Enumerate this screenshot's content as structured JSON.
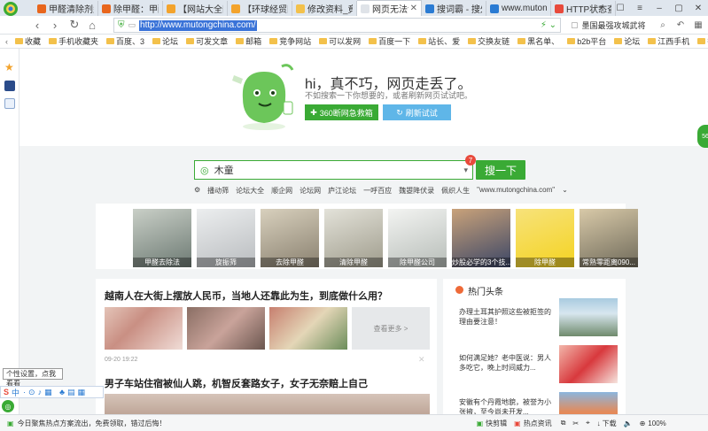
{
  "tabs": [
    {
      "label": "甲醛清除剂型",
      "color": "#e8661d",
      "active": false
    },
    {
      "label": "除甲醛：甲醛",
      "color": "#e8661d",
      "active": false
    },
    {
      "label": "【网站大全网",
      "color": "#f3a32c",
      "active": false
    },
    {
      "label": "【环球经贸网",
      "color": "#f3a32c",
      "active": false
    },
    {
      "label": "修改资料_竟争",
      "color": "#f3c14b",
      "active": false
    },
    {
      "label": "网页无法访问",
      "color": "#dfe3e8",
      "active": true
    },
    {
      "label": "搜词霸 - 搜外",
      "color": "#2a7bd3",
      "active": false
    },
    {
      "label": "www.muton...",
      "color": "#2a7bd3",
      "active": false
    },
    {
      "label": "HTTP状态查询",
      "color": "#e84a3c",
      "active": false
    }
  ],
  "nav": {
    "url": "http://www.mutongchina.com/",
    "search_text": "墨国最强攻城武将"
  },
  "bookmarks": [
    "收藏",
    "手机收藏夹",
    "百度、3",
    "论坛",
    "可发文章",
    "邮箱",
    "竞争网站",
    "可以发网",
    "百度一下",
    "站长、爱",
    "交换友链",
    "黑名单、",
    "b2b平台",
    "论坛",
    "江西手机",
    "待确认可"
  ],
  "error": {
    "title": "hi，真不巧，网页走丢了。",
    "subtitle": "不如搜索一下你想要的，或者刷新网页试试吧。",
    "btn_help": "360断网急救箱",
    "btn_refresh": "刷新试试"
  },
  "search": {
    "value": "木童",
    "badge": "7",
    "button": "搜一下",
    "links": [
      "播动筛",
      "论坛大全",
      "顺企网",
      "论坛网",
      "庐江论坛",
      "一呼百应",
      "魏曌降伏录",
      "佩织人生",
      "\"www.mutongchina.com\""
    ]
  },
  "thumbs": [
    {
      "caption": "甲醛去除法",
      "c1": "#6d7a73",
      "c2": "#c9cfc7"
    },
    {
      "caption": "旋振筛",
      "c1": "#b9bcbf",
      "c2": "#eceeef"
    },
    {
      "caption": "去除甲醛",
      "c1": "#8a8170",
      "c2": "#d8d0bd"
    },
    {
      "caption": "清除甲醛",
      "c1": "#9f9c8c",
      "c2": "#e3e2d9"
    },
    {
      "caption": "除甲醛公司",
      "c1": "#b7bdb8",
      "c2": "#f3f4f2"
    },
    {
      "caption": "炒股必学的3个技...",
      "c1": "#3b4666",
      "c2": "#c9a27a"
    },
    {
      "caption": "除甲醛",
      "c1": "#f4d321",
      "c2": "#f7e27a"
    },
    {
      "caption": "常熟零距离090...",
      "c1": "#6f6a5a",
      "c2": "#d8c9a8"
    }
  ],
  "news": {
    "headline": "越南人在大街上摆放人民币，当地人还靠此为生，到底做什么用？",
    "more": "查看更多 >",
    "time": "09-20 19:22",
    "headline2": "男子车站住宿被仙人跳，机智反套路女子，女子无奈赔上自己"
  },
  "hot": {
    "title": "热门头条",
    "items": [
      "办理土耳其护照这些被拒签的理由要注意！",
      "如何满足她？老中医说：男人多吃它，晚上时间威力...",
      "安徽有个丹霞地貌，被誉为小张掖，至今尚未开发..."
    ]
  },
  "tooltip": "个性设置，点我看看",
  "ime": {
    "label": "中"
  },
  "status": {
    "news": "今日聚焦热点方案流出，免费领取，错过后悔！",
    "speed": "快剪辑",
    "hot": "热点资讯",
    "download": "下载",
    "zoom": "100%"
  },
  "colors": {
    "green": "#3aaa35",
    "blue": "#3a73d8"
  }
}
